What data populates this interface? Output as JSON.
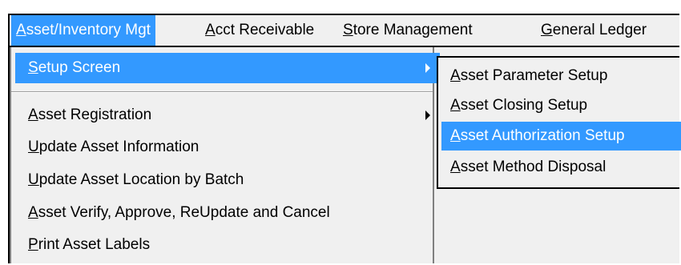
{
  "menubar": {
    "items": [
      {
        "label": "Asset/Inventory Mgt",
        "mnemonic": "A",
        "rest": "sset/Inventory Mgt",
        "active": true
      },
      {
        "label": "Acct Receivable",
        "mnemonic": "A",
        "rest": "cct Receivable",
        "active": false
      },
      {
        "label": "Store Management",
        "mnemonic": "S",
        "rest": "tore Management",
        "active": false
      },
      {
        "label": "General Ledger",
        "mnemonic": "G",
        "rest": "eneral Ledger",
        "active": false
      }
    ]
  },
  "dropdown": {
    "items": [
      {
        "label": "Setup Screen",
        "mnemonic": "S",
        "rest": "etup Screen",
        "active": true,
        "submenu": true
      },
      {
        "label": "Asset Registration",
        "mnemonic": "A",
        "rest": "sset Registration",
        "active": false,
        "submenu": true
      },
      {
        "label": "Update Asset Information",
        "mnemonic": "U",
        "rest": "pdate Asset Information",
        "active": false,
        "submenu": false
      },
      {
        "label": "Update Asset Location by Batch",
        "mnemonic": "U",
        "rest": "pdate Asset Location by Batch",
        "active": false,
        "submenu": false
      },
      {
        "label": "Asset Verify, Approve, ReUpdate and Cancel",
        "mnemonic": "A",
        "rest": "sset Verify, Approve, ReUpdate and Cancel",
        "active": false,
        "submenu": false
      },
      {
        "label": "Print Asset Labels",
        "mnemonic": "P",
        "rest": "rint Asset Labels",
        "active": false,
        "submenu": false
      }
    ]
  },
  "submenu": {
    "items": [
      {
        "label": "Asset Parameter Setup",
        "mnemonic": "A",
        "rest": "sset Parameter Setup",
        "active": false
      },
      {
        "label": "Asset Closing Setup",
        "mnemonic": "A",
        "rest": "sset Closing Setup",
        "active": false
      },
      {
        "label": "Asset Authorization Setup",
        "mnemonic": "A",
        "rest": "sset Authorization Setup",
        "active": true
      },
      {
        "label": "Asset Method Disposal",
        "mnemonic": "A",
        "rest": "sset Method Disposal",
        "active": false
      }
    ]
  },
  "colors": {
    "highlight": "#3399ff",
    "menu_background": "#f0f0f0"
  }
}
